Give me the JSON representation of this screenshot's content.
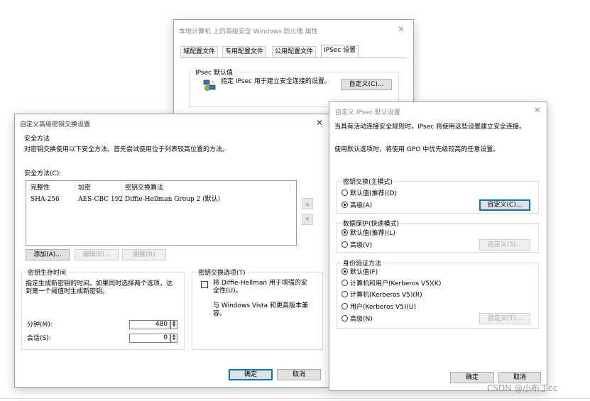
{
  "back_window": {
    "title": "本地计算机 上的高级安全 Windows 防火墙 属性",
    "tabs": [
      "域配置文件",
      "专用配置文件",
      "公用配置文件",
      "IPSec 设置"
    ],
    "group_label": "IPsec 默认值",
    "desc": "指定 IPsec 用于建立安全连接的设置。",
    "customize_button": "自定义(C)..."
  },
  "ike_dialog": {
    "title": "自定义高级密钥交换设置",
    "security_methods_heading": "安全方法",
    "security_methods_desc": "对密钥交换使用以下安全方法。首先尝试使用位于列表较高位置的方法。",
    "list_label": "安全方法(C):",
    "columns": [
      "完整性",
      "加密",
      "密钥交换算法"
    ],
    "rows": [
      {
        "integrity": "SHA-256",
        "encryption": "AES-CBC 192",
        "key_exchange": "Diffie-Hellman Group 2 (默认)"
      }
    ],
    "add_button": "添加(A)...",
    "edit_button": "编辑(E)...",
    "delete_button": "删除(R)",
    "key_lifetime_label": "密钥生存时间",
    "key_lifetime_desc": "指定生成新密钥的时间。如果同时选择两个选项，达到第一个阈值时生成新密钥。",
    "minutes_label": "分钟(M):",
    "minutes_value": "480",
    "sessions_label": "会话(S):",
    "sessions_value": "0",
    "kex_options_label": "密钥交换选项(T)",
    "dh_checkbox_label": "将 Diffie-Hellman 用于增强的安全性(U)。",
    "dh_checkbox_checked": false,
    "compat_note": "与 Windows Vista 和更高版本兼容。",
    "ok_button": "确定",
    "cancel_button": "取消"
  },
  "ipsec_dialog": {
    "title": "自定义 IPsec 默认设置",
    "desc1": "当具有活动连接安全规则时，IPsec 将使用这些设置建立安全连接。",
    "desc2": "使用默认选项时，将使用 GPO 中优先级较高的任意设置。",
    "key_exchange_group": "密钥交换(主模式)",
    "kx_default": "默认值(推荐)(D)",
    "kx_advanced": "高级(A)",
    "kx_selected": "advanced",
    "kx_customize": "自定义(C)...",
    "data_protection_group": "数据保护(快速模式)",
    "dp_default": "默认值(推荐)(L)",
    "dp_advanced": "高级(V)",
    "dp_selected": "default",
    "dp_customize": "自定义(S)...",
    "auth_group": "身份验证方法",
    "auth_options": [
      "默认值(F)",
      "计算机和用户(Kerberos V5)(K)",
      "计算机(Kerberos V5)(R)",
      "用户(Kerberos V5)(U)",
      "高级(N)"
    ],
    "auth_selected_index": 0,
    "auth_customize": "自定义(T)...",
    "ok_button": "确定",
    "cancel_button": "取消"
  },
  "watermark": "CSDN @小布丁cc",
  "colors": {
    "accent": "#0078d7",
    "border": "#7a9cc8"
  }
}
